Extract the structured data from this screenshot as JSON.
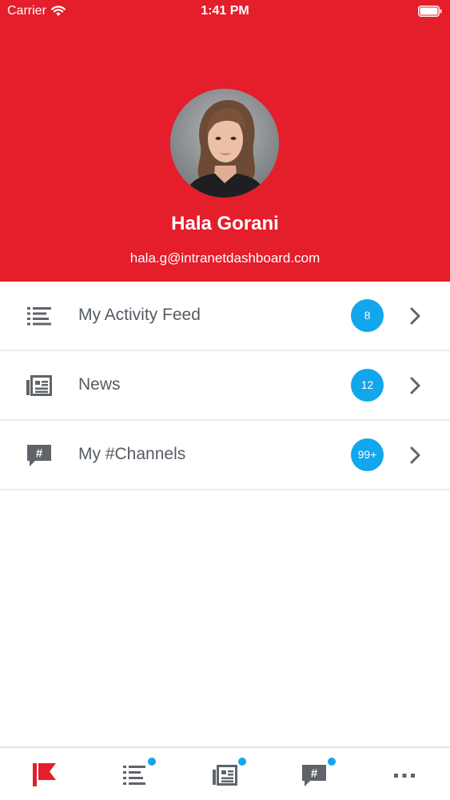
{
  "status_bar": {
    "carrier": "Carrier",
    "time": "1:41 PM"
  },
  "profile": {
    "name": "Hala Gorani",
    "email": "hala.g@intranetdashboard.com"
  },
  "menu": {
    "items": [
      {
        "label": "My Activity Feed",
        "badge": "8",
        "icon": "list-icon"
      },
      {
        "label": "News",
        "badge": "12",
        "icon": "newspaper-icon"
      },
      {
        "label": "My #Channels",
        "badge": "99+",
        "icon": "channel-chat-icon"
      }
    ]
  },
  "tab_bar": {
    "tabs": [
      {
        "icon": "flag-icon",
        "active": true,
        "has_dot": false
      },
      {
        "icon": "list-icon",
        "active": false,
        "has_dot": true
      },
      {
        "icon": "newspaper-icon",
        "active": false,
        "has_dot": true
      },
      {
        "icon": "channel-chat-icon",
        "active": false,
        "has_dot": true
      },
      {
        "icon": "more-icon",
        "active": false,
        "has_dot": false
      }
    ]
  },
  "colors": {
    "brand_red": "#e41e2a",
    "badge_blue": "#12a6ec",
    "icon_gray": "#5f646b",
    "text_gray": "#555b63"
  }
}
